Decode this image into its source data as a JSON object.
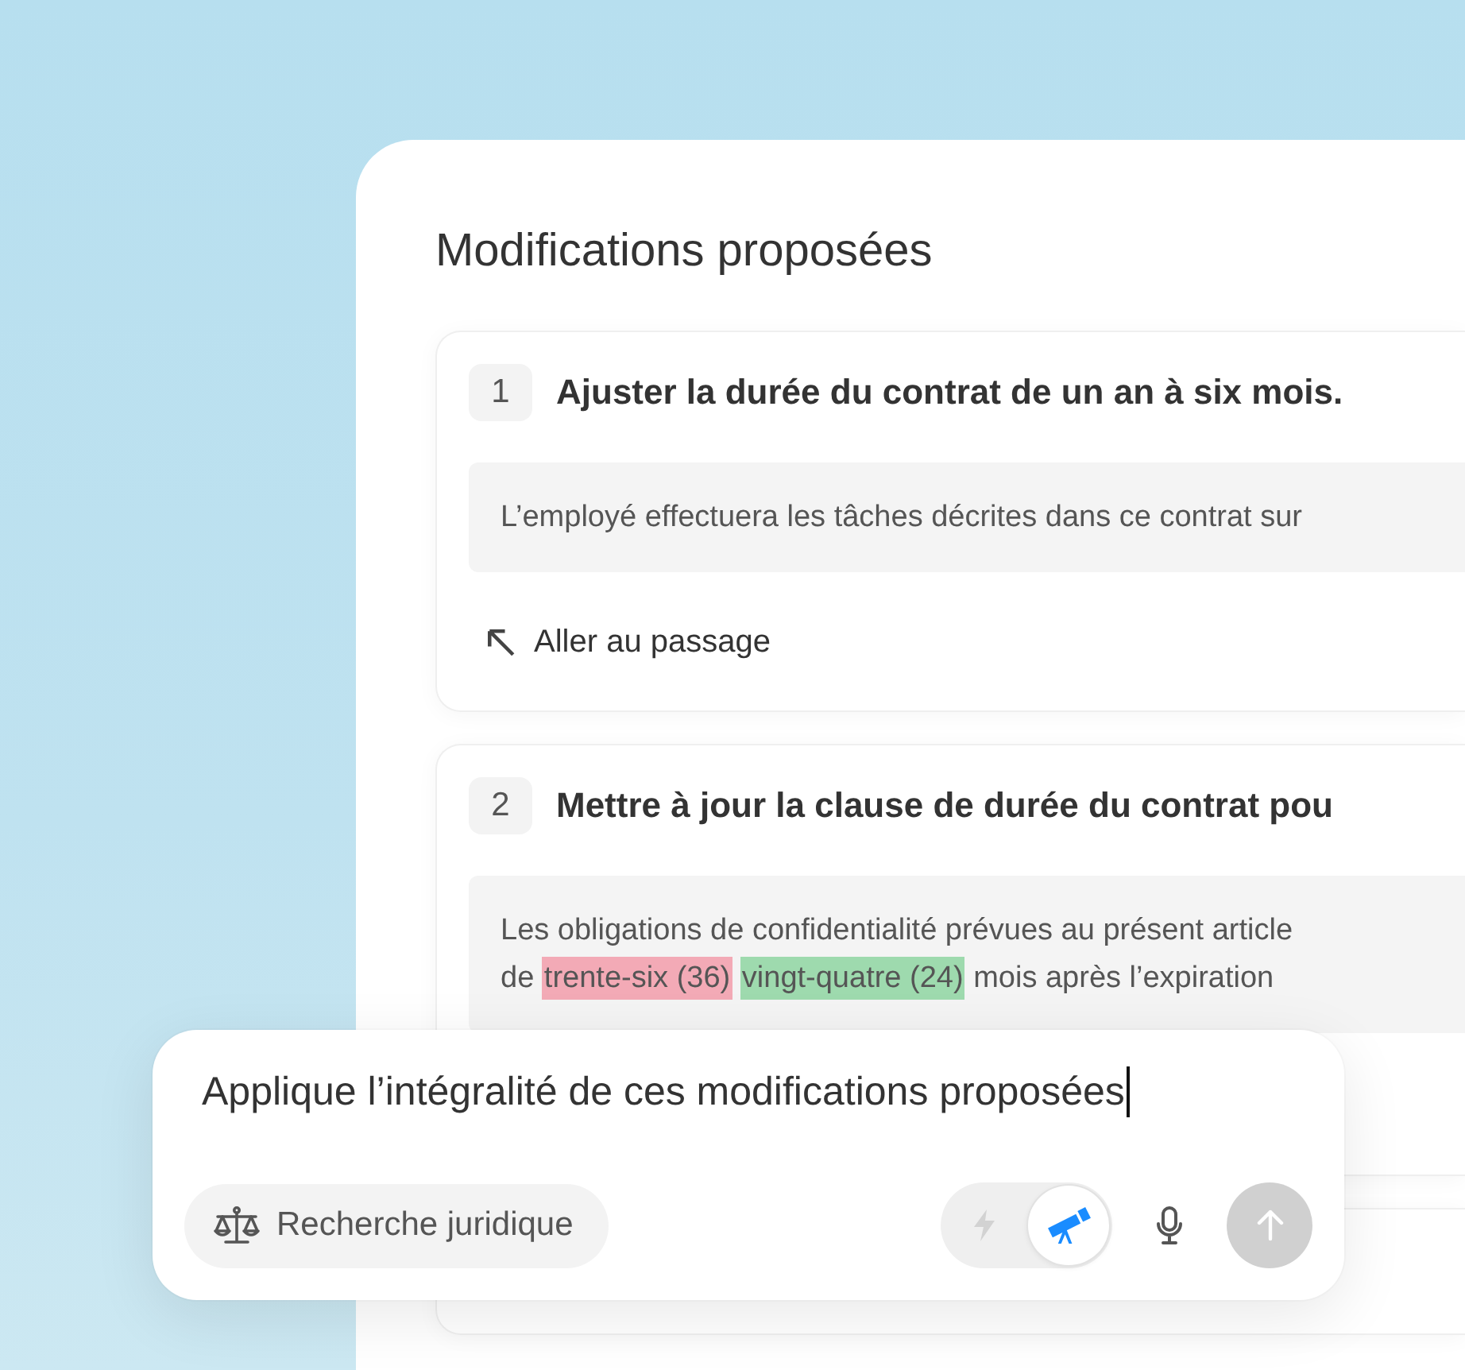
{
  "panel": {
    "title": "Modifications proposées"
  },
  "cards": [
    {
      "number": "1",
      "title": "Ajuster la durée du contrat de un an à six mois.",
      "quote": [
        [
          {
            "kind": "plain",
            "text": "L’employé effectuera les tâches décrites dans ce contrat sur"
          }
        ]
      ],
      "link": "Aller au passage"
    },
    {
      "number": "2",
      "title": "Mettre à jour la clause de durée du contrat pou",
      "quote": [
        [
          {
            "kind": "plain",
            "text": "Les obligations de confidentialité prévues au présent article"
          }
        ],
        [
          {
            "kind": "plain",
            "text": "de "
          },
          {
            "kind": "deleted",
            "text": "trente-six (36) "
          },
          {
            "kind": "inserted",
            "text": "vingt-quatre (24)"
          },
          {
            "kind": "plain",
            "text": " mois après l’expiration"
          }
        ]
      ]
    }
  ],
  "composer": {
    "value": "Applique l’intégralité de ces modifications proposées",
    "focused": true,
    "tool_chip": {
      "label": "Recherche juridique"
    },
    "modes": [
      {
        "kind": "lightning",
        "selected": false
      },
      {
        "kind": "telescope",
        "selected": true
      }
    ],
    "send_button": {
      "disabled": true
    }
  }
}
